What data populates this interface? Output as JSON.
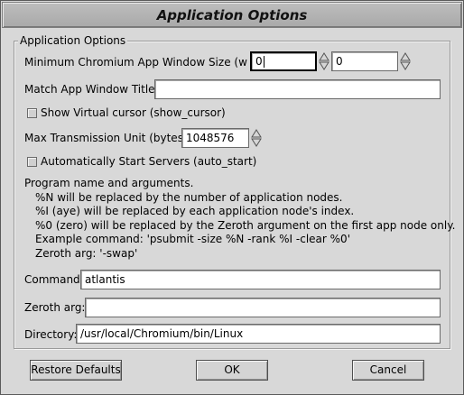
{
  "window": {
    "title": "Application Options"
  },
  "group": {
    "title": "Application Options"
  },
  "min_window_size": {
    "label": "Minimum Chromium App Window Size (w h):",
    "width": "0",
    "height": "0"
  },
  "match_title": {
    "label": "Match App Window Title:",
    "value": ""
  },
  "show_cursor": {
    "label": "Show Virtual cursor (show_cursor)",
    "checked": false
  },
  "mtu": {
    "label": "Max Transmission Unit (bytes):",
    "value": "1048576"
  },
  "auto_start": {
    "label": "Automatically Start Servers (auto_start)",
    "checked": false
  },
  "help_text": {
    "line1": "Program name and arguments.",
    "line2": "%N will be replaced by the number of application nodes.",
    "line3": "%I (aye) will be replaced by each application node's index.",
    "line4": "%0 (zero) will be replaced by the Zeroth argument on the first app node only.",
    "line5": "Example command: 'psubmit -size %N -rank %I -clear %0'",
    "line6": "Zeroth arg: '-swap'"
  },
  "command": {
    "label": "Command:",
    "value": "atlantis"
  },
  "zeroth_arg": {
    "label": "Zeroth arg:",
    "value": ""
  },
  "directory": {
    "label": "Directory:",
    "value": "/usr/local/Chromium/bin/Linux"
  },
  "buttons": {
    "restore_defaults": "Restore Defaults",
    "ok": "OK",
    "cancel": "Cancel"
  },
  "icons": {
    "spin": "spin-arrows-icon",
    "checkbox": "checkbox-unchecked-icon"
  }
}
